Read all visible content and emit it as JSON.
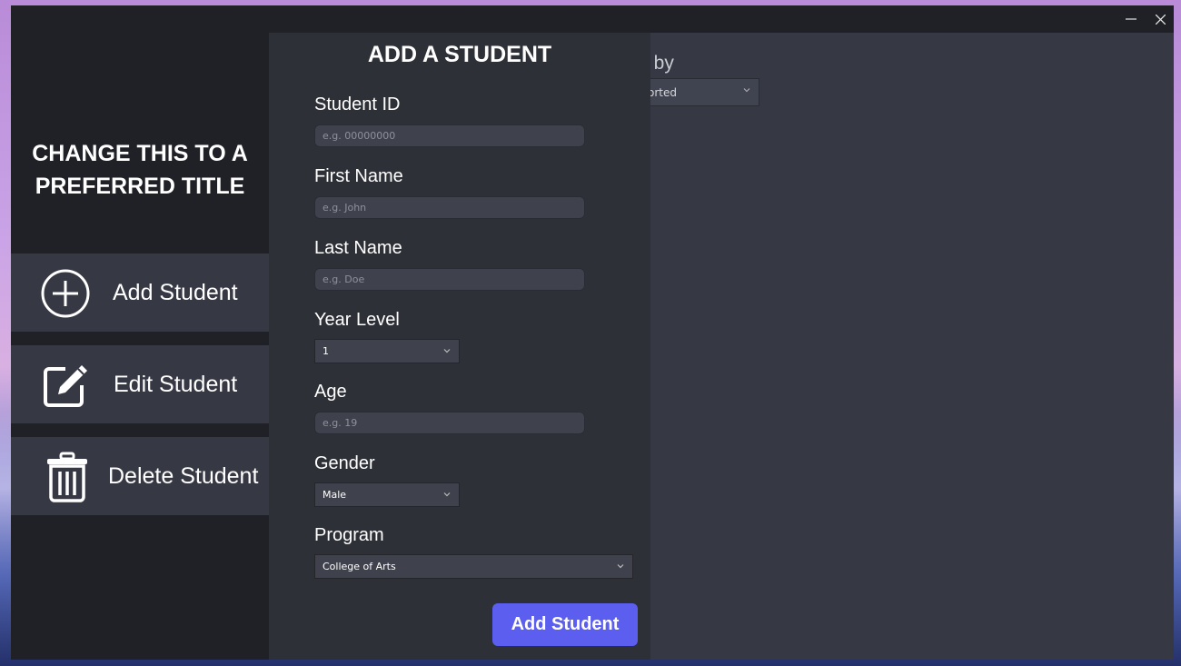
{
  "window": {
    "minimize_icon": "minimize-icon",
    "close_icon": "close-icon"
  },
  "sidebar": {
    "title_line1": "CHANGE THIS TO A",
    "title_line2": "PREFERRED TITLE",
    "items": [
      {
        "label": "Add Student",
        "icon": "plus-circle-icon"
      },
      {
        "label": "Edit Student",
        "icon": "edit-icon"
      },
      {
        "label": "Delete Student",
        "icon": "trash-icon"
      }
    ]
  },
  "sort": {
    "label_visible": "t by",
    "value_visible": "orted"
  },
  "form": {
    "title": "ADD A STUDENT",
    "student_id": {
      "label": "Student ID",
      "placeholder": "e.g. 00000000"
    },
    "first_name": {
      "label": "First Name",
      "placeholder": "e.g. John"
    },
    "last_name": {
      "label": "Last Name",
      "placeholder": "e.g. Doe"
    },
    "year_level": {
      "label": "Year Level",
      "value": "1"
    },
    "age": {
      "label": "Age",
      "placeholder": "e.g. 19"
    },
    "gender": {
      "label": "Gender",
      "value": "Male"
    },
    "program": {
      "label": "Program",
      "value": "College of Arts"
    },
    "submit_label": "Add Student"
  },
  "colors": {
    "sidebar_bg": "#1f2127",
    "panel_bg": "#2e3037",
    "accent": "#5c5ef0"
  }
}
